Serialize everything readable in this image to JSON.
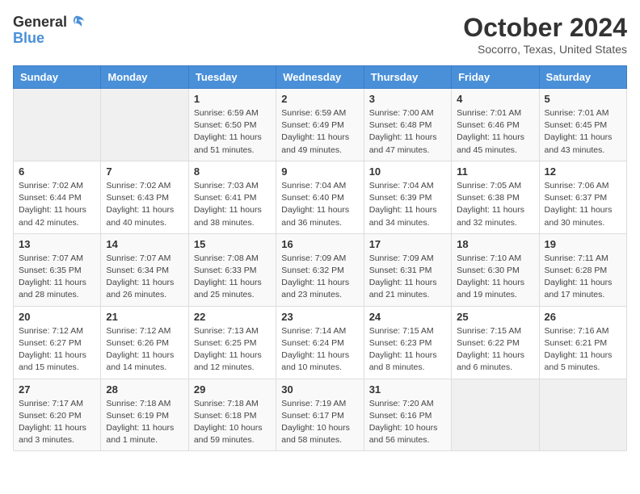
{
  "header": {
    "logo_general": "General",
    "logo_blue": "Blue",
    "title": "October 2024",
    "subtitle": "Socorro, Texas, United States"
  },
  "weekdays": [
    "Sunday",
    "Monday",
    "Tuesday",
    "Wednesday",
    "Thursday",
    "Friday",
    "Saturday"
  ],
  "weeks": [
    [
      {
        "day": "",
        "info": ""
      },
      {
        "day": "",
        "info": ""
      },
      {
        "day": "1",
        "info": "Sunrise: 6:59 AM\nSunset: 6:50 PM\nDaylight: 11 hours and 51 minutes."
      },
      {
        "day": "2",
        "info": "Sunrise: 6:59 AM\nSunset: 6:49 PM\nDaylight: 11 hours and 49 minutes."
      },
      {
        "day": "3",
        "info": "Sunrise: 7:00 AM\nSunset: 6:48 PM\nDaylight: 11 hours and 47 minutes."
      },
      {
        "day": "4",
        "info": "Sunrise: 7:01 AM\nSunset: 6:46 PM\nDaylight: 11 hours and 45 minutes."
      },
      {
        "day": "5",
        "info": "Sunrise: 7:01 AM\nSunset: 6:45 PM\nDaylight: 11 hours and 43 minutes."
      }
    ],
    [
      {
        "day": "6",
        "info": "Sunrise: 7:02 AM\nSunset: 6:44 PM\nDaylight: 11 hours and 42 minutes."
      },
      {
        "day": "7",
        "info": "Sunrise: 7:02 AM\nSunset: 6:43 PM\nDaylight: 11 hours and 40 minutes."
      },
      {
        "day": "8",
        "info": "Sunrise: 7:03 AM\nSunset: 6:41 PM\nDaylight: 11 hours and 38 minutes."
      },
      {
        "day": "9",
        "info": "Sunrise: 7:04 AM\nSunset: 6:40 PM\nDaylight: 11 hours and 36 minutes."
      },
      {
        "day": "10",
        "info": "Sunrise: 7:04 AM\nSunset: 6:39 PM\nDaylight: 11 hours and 34 minutes."
      },
      {
        "day": "11",
        "info": "Sunrise: 7:05 AM\nSunset: 6:38 PM\nDaylight: 11 hours and 32 minutes."
      },
      {
        "day": "12",
        "info": "Sunrise: 7:06 AM\nSunset: 6:37 PM\nDaylight: 11 hours and 30 minutes."
      }
    ],
    [
      {
        "day": "13",
        "info": "Sunrise: 7:07 AM\nSunset: 6:35 PM\nDaylight: 11 hours and 28 minutes."
      },
      {
        "day": "14",
        "info": "Sunrise: 7:07 AM\nSunset: 6:34 PM\nDaylight: 11 hours and 26 minutes."
      },
      {
        "day": "15",
        "info": "Sunrise: 7:08 AM\nSunset: 6:33 PM\nDaylight: 11 hours and 25 minutes."
      },
      {
        "day": "16",
        "info": "Sunrise: 7:09 AM\nSunset: 6:32 PM\nDaylight: 11 hours and 23 minutes."
      },
      {
        "day": "17",
        "info": "Sunrise: 7:09 AM\nSunset: 6:31 PM\nDaylight: 11 hours and 21 minutes."
      },
      {
        "day": "18",
        "info": "Sunrise: 7:10 AM\nSunset: 6:30 PM\nDaylight: 11 hours and 19 minutes."
      },
      {
        "day": "19",
        "info": "Sunrise: 7:11 AM\nSunset: 6:28 PM\nDaylight: 11 hours and 17 minutes."
      }
    ],
    [
      {
        "day": "20",
        "info": "Sunrise: 7:12 AM\nSunset: 6:27 PM\nDaylight: 11 hours and 15 minutes."
      },
      {
        "day": "21",
        "info": "Sunrise: 7:12 AM\nSunset: 6:26 PM\nDaylight: 11 hours and 14 minutes."
      },
      {
        "day": "22",
        "info": "Sunrise: 7:13 AM\nSunset: 6:25 PM\nDaylight: 11 hours and 12 minutes."
      },
      {
        "day": "23",
        "info": "Sunrise: 7:14 AM\nSunset: 6:24 PM\nDaylight: 11 hours and 10 minutes."
      },
      {
        "day": "24",
        "info": "Sunrise: 7:15 AM\nSunset: 6:23 PM\nDaylight: 11 hours and 8 minutes."
      },
      {
        "day": "25",
        "info": "Sunrise: 7:15 AM\nSunset: 6:22 PM\nDaylight: 11 hours and 6 minutes."
      },
      {
        "day": "26",
        "info": "Sunrise: 7:16 AM\nSunset: 6:21 PM\nDaylight: 11 hours and 5 minutes."
      }
    ],
    [
      {
        "day": "27",
        "info": "Sunrise: 7:17 AM\nSunset: 6:20 PM\nDaylight: 11 hours and 3 minutes."
      },
      {
        "day": "28",
        "info": "Sunrise: 7:18 AM\nSunset: 6:19 PM\nDaylight: 11 hours and 1 minute."
      },
      {
        "day": "29",
        "info": "Sunrise: 7:18 AM\nSunset: 6:18 PM\nDaylight: 10 hours and 59 minutes."
      },
      {
        "day": "30",
        "info": "Sunrise: 7:19 AM\nSunset: 6:17 PM\nDaylight: 10 hours and 58 minutes."
      },
      {
        "day": "31",
        "info": "Sunrise: 7:20 AM\nSunset: 6:16 PM\nDaylight: 10 hours and 56 minutes."
      },
      {
        "day": "",
        "info": ""
      },
      {
        "day": "",
        "info": ""
      }
    ]
  ]
}
